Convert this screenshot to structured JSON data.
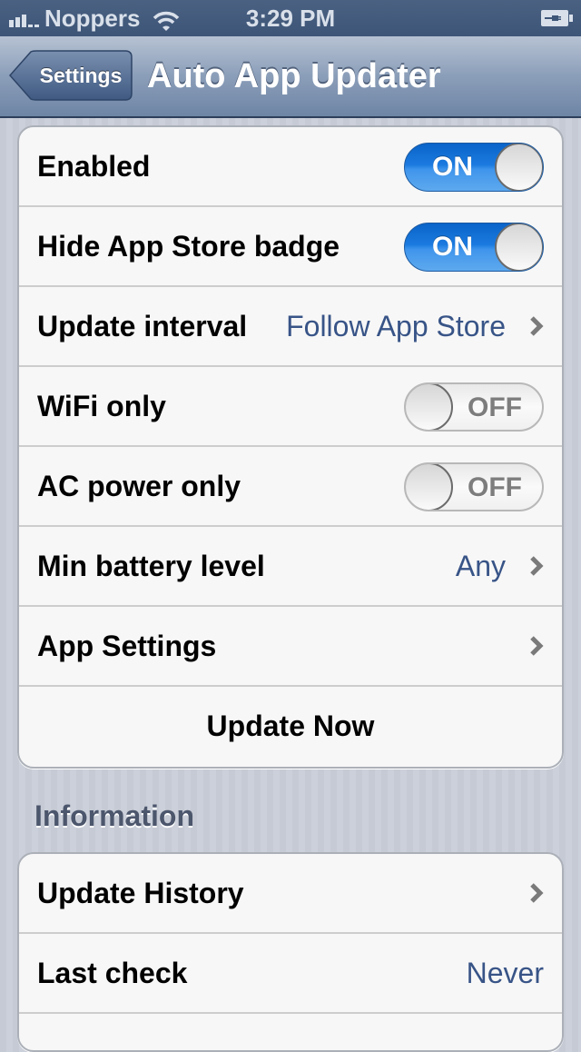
{
  "status_bar": {
    "carrier": "Noppers",
    "time": "3:29 PM",
    "signal_bars": 3,
    "signal_bars_total": 5,
    "wifi_icon": "wifi-icon",
    "battery_icon": "battery-charging-icon"
  },
  "nav": {
    "back_label": "Settings",
    "title": "Auto App Updater"
  },
  "main_group": {
    "rows": [
      {
        "label": "Enabled",
        "type": "switch",
        "switch_text": "ON",
        "on": true
      },
      {
        "label": "Hide App Store badge",
        "type": "switch",
        "switch_text": "ON",
        "on": true
      },
      {
        "label": "Update interval",
        "type": "disclosure",
        "value": "Follow App Store"
      },
      {
        "label": "WiFi only",
        "type": "switch",
        "switch_text": "OFF",
        "on": false
      },
      {
        "label": "AC power only",
        "type": "switch",
        "switch_text": "OFF",
        "on": false
      },
      {
        "label": "Min battery level",
        "type": "disclosure",
        "value": "Any"
      },
      {
        "label": "App Settings",
        "type": "disclosure",
        "value": ""
      },
      {
        "label": "Update Now",
        "type": "button"
      }
    ]
  },
  "info_section": {
    "header": "Information",
    "rows": [
      {
        "label": "Update History",
        "type": "disclosure"
      },
      {
        "label": "Last check",
        "type": "value",
        "value": "Never"
      }
    ]
  },
  "colors": {
    "value_text": "#385487",
    "switch_on": "#1b7ae0",
    "nav_bar": "#8b9eb9",
    "status_bar": "#3d5577"
  }
}
